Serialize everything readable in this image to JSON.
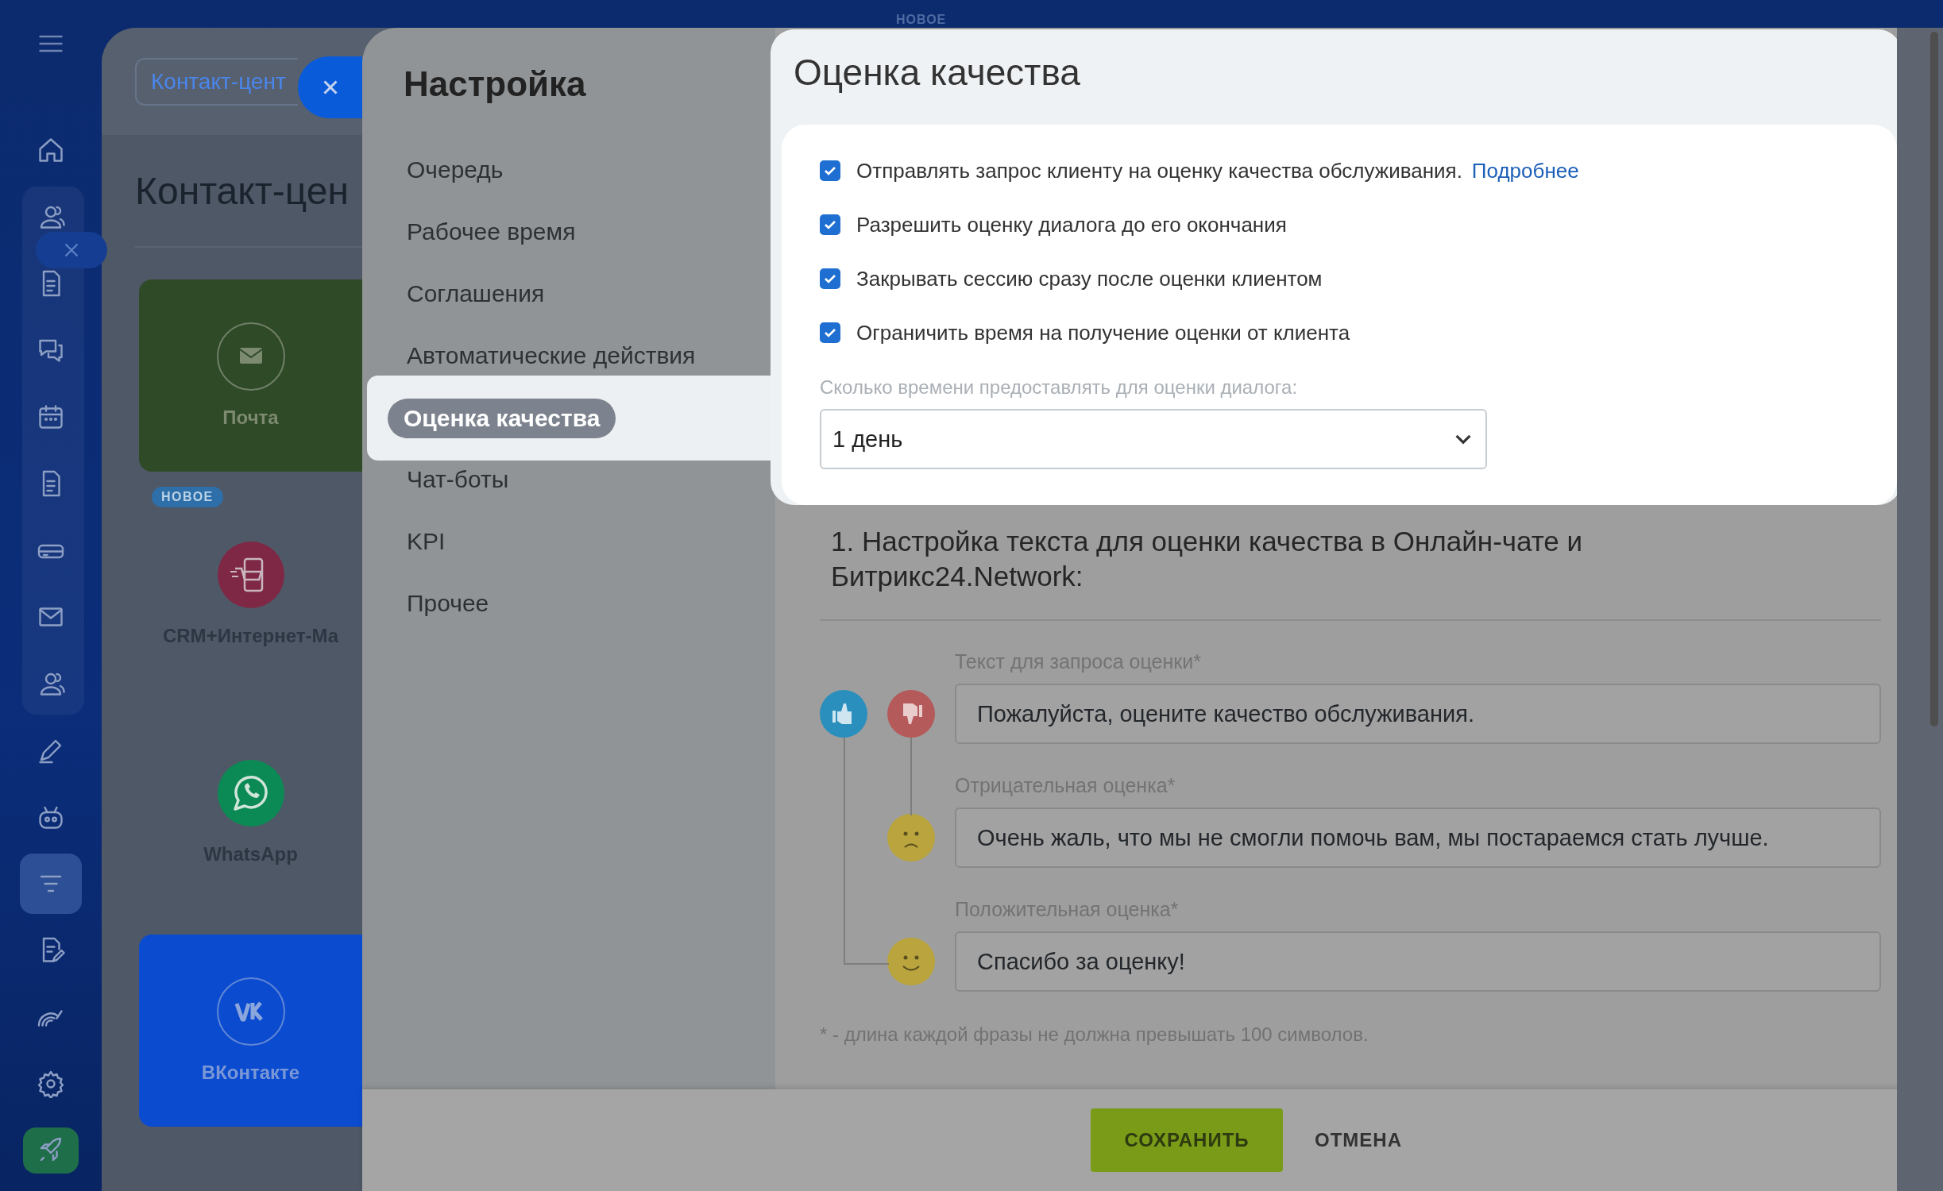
{
  "rail": {
    "items": [
      {
        "kind": "menu",
        "selected": false
      },
      {
        "kind": "home",
        "selected": false
      },
      {
        "kind": "people",
        "selected": false
      },
      {
        "kind": "doc",
        "selected": false
      },
      {
        "kind": "chat",
        "selected": false
      },
      {
        "kind": "calendar",
        "selected": false
      },
      {
        "kind": "doc",
        "selected": false
      },
      {
        "kind": "drive",
        "selected": false
      },
      {
        "kind": "mail",
        "selected": false
      },
      {
        "kind": "people",
        "selected": false
      },
      {
        "kind": "pen",
        "selected": false
      },
      {
        "kind": "robot",
        "selected": false
      },
      {
        "kind": "filter",
        "selected": true
      },
      {
        "kind": "docedit",
        "selected": false
      },
      {
        "kind": "gauge",
        "selected": false
      },
      {
        "kind": "gear",
        "selected": false
      },
      {
        "kind": "rocket",
        "selected": false
      }
    ]
  },
  "top_badge": "НОВОЕ",
  "background_page": {
    "tab": "Контакт-цент",
    "title": "Контакт-цен",
    "cards": [
      {
        "kind": "mail",
        "label": "Почта",
        "color": "#2f4a27"
      },
      {
        "kind": "shop",
        "label": "CRM+Интернет-Ма",
        "badge": "НОВОЕ",
        "color": "#4f5866"
      },
      {
        "kind": "whatsapp",
        "label": "WhatsApp",
        "color": "#4f5866"
      },
      {
        "kind": "vk",
        "label": "ВКонтакте",
        "color": "#0b4bd0"
      }
    ]
  },
  "settings": {
    "title": "Настройка",
    "items": [
      {
        "label": "Очередь",
        "selected": false
      },
      {
        "label": "Рабочее время",
        "selected": false
      },
      {
        "label": "Соглашения",
        "selected": false
      },
      {
        "label": "Автоматические действия",
        "selected": false
      },
      {
        "label": "Оценка качества",
        "selected": true
      },
      {
        "label": "Чат-боты",
        "selected": false
      },
      {
        "label": "KPI",
        "selected": false
      },
      {
        "label": "Прочее",
        "selected": false
      }
    ]
  },
  "quality": {
    "title": "Оценка качества",
    "options": [
      {
        "label": "Отправлять запрос клиенту на оценку качества обслуживания.",
        "link": "Подробнее",
        "checked": true
      },
      {
        "label": "Разрешить оценку диалога до его окончания",
        "checked": true
      },
      {
        "label": "Закрывать сессию сразу после оценки клиентом",
        "checked": true
      },
      {
        "label": "Ограничить время на получение оценки от клиента",
        "checked": true
      }
    ],
    "duration_label": "Сколько времени предоставлять для оценки диалога:",
    "duration_value": "1 день",
    "section_title": "1. Настройка текста для оценки качества в Онлайн-чате и Битрикс24.Network:",
    "fields": [
      {
        "kind": "request",
        "label": "Текст для запроса оценки*",
        "value": "Пожалуйста, оцените качество обслуживания."
      },
      {
        "kind": "negative",
        "label": "Отрицательная оценка*",
        "value": "Очень жаль, что мы не смогли помочь вам, мы постараемся стать лучше."
      },
      {
        "kind": "positive",
        "label": "Положительная оценка*",
        "value": "Спасибо за оценку!"
      }
    ],
    "footnote": "* - длина каждой фразы не должна превышать 100 символов."
  },
  "footer": {
    "buttons": [
      {
        "kind": "primary",
        "label": "СОХРАНИТЬ"
      },
      {
        "kind": "plain",
        "label": "ОТМЕНА"
      }
    ]
  }
}
